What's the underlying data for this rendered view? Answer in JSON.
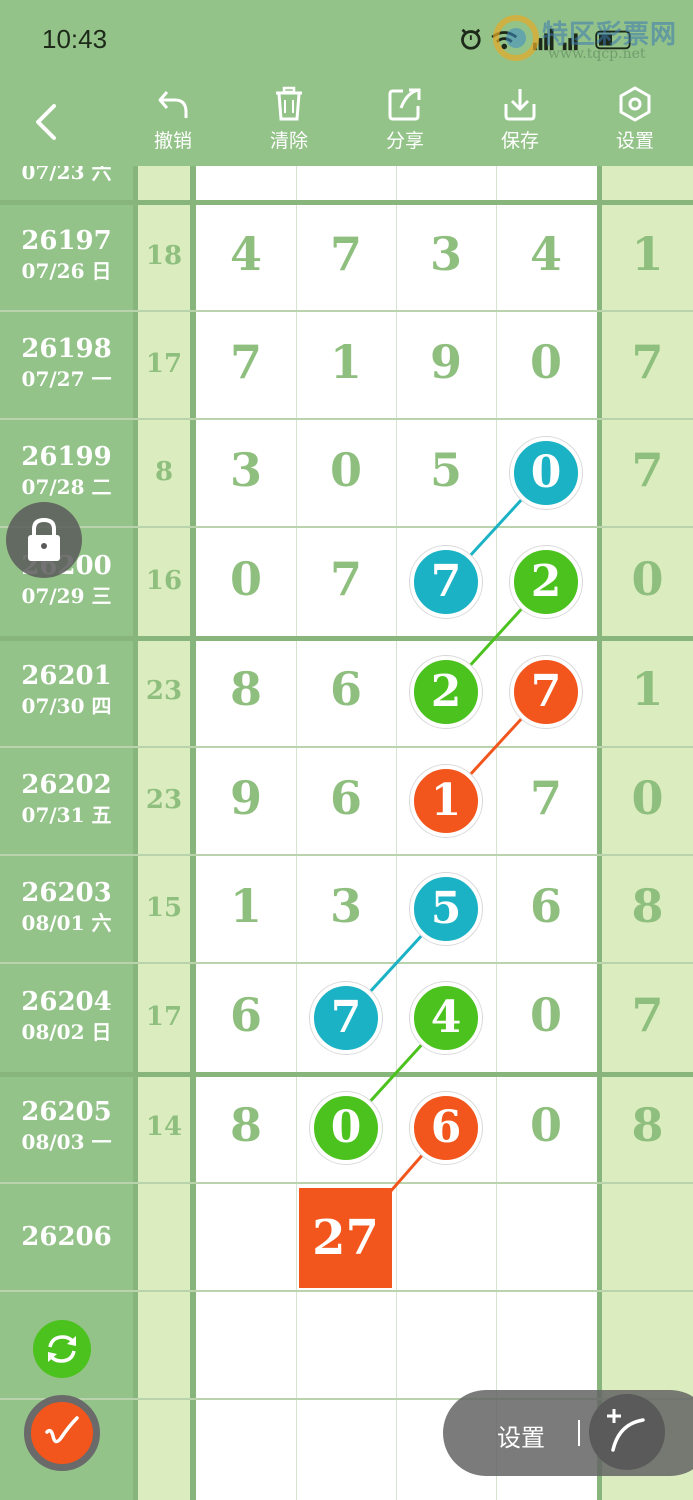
{
  "status_bar": {
    "time": "10:43",
    "signal": "5G"
  },
  "watermark": {
    "name": "特区彩票网",
    "url": "www.tqcp.net"
  },
  "toolbar": {
    "undo_label": "撤销",
    "clear_label": "清除",
    "share_label": "分享",
    "save_label": "保存",
    "settings_label": "设置"
  },
  "partial_top_row": {
    "date": "07/23 六"
  },
  "rows": [
    {
      "id": "26197",
      "date": "07/26 日",
      "sum": "18",
      "digits": [
        "4",
        "7",
        "3",
        "4"
      ],
      "extra": "1"
    },
    {
      "id": "26198",
      "date": "07/27 一",
      "sum": "17",
      "digits": [
        "7",
        "1",
        "9",
        "0"
      ],
      "extra": "7"
    },
    {
      "id": "26199",
      "date": "07/28 二",
      "sum": "8",
      "digits": [
        "3",
        "0",
        "5",
        "0"
      ],
      "extra": "7"
    },
    {
      "id": "26200",
      "date": "07/29 三",
      "sum": "16",
      "digits": [
        "0",
        "7",
        "7",
        "2"
      ],
      "extra": "0"
    },
    {
      "id": "26201",
      "date": "07/30 四",
      "sum": "23",
      "digits": [
        "8",
        "6",
        "2",
        "7"
      ],
      "extra": "1"
    },
    {
      "id": "26202",
      "date": "07/31 五",
      "sum": "23",
      "digits": [
        "9",
        "6",
        "1",
        "7"
      ],
      "extra": "0"
    },
    {
      "id": "26203",
      "date": "08/01 六",
      "sum": "15",
      "digits": [
        "1",
        "3",
        "5",
        "6"
      ],
      "extra": "8"
    },
    {
      "id": "26204",
      "date": "08/02 日",
      "sum": "17",
      "digits": [
        "6",
        "7",
        "4",
        "0"
      ],
      "extra": "7"
    },
    {
      "id": "26205",
      "date": "08/03 一",
      "sum": "14",
      "digits": [
        "8",
        "0",
        "6",
        "0"
      ],
      "extra": "8"
    },
    {
      "id": "26206",
      "date": "",
      "sum": "",
      "digits": [
        "",
        "",
        "",
        ""
      ],
      "extra": ""
    }
  ],
  "prediction": {
    "value": "27"
  },
  "highlights": [
    {
      "row": 2,
      "col": 3,
      "color": "teal"
    },
    {
      "row": 3,
      "col": 2,
      "color": "teal"
    },
    {
      "row": 3,
      "col": 3,
      "color": "green"
    },
    {
      "row": 4,
      "col": 2,
      "color": "green"
    },
    {
      "row": 4,
      "col": 3,
      "color": "orange"
    },
    {
      "row": 5,
      "col": 2,
      "color": "orange"
    },
    {
      "row": 6,
      "col": 2,
      "color": "teal"
    },
    {
      "row": 7,
      "col": 1,
      "color": "teal"
    },
    {
      "row": 7,
      "col": 2,
      "color": "green"
    },
    {
      "row": 8,
      "col": 1,
      "color": "green"
    },
    {
      "row": 8,
      "col": 2,
      "color": "orange"
    }
  ],
  "colors": {
    "teal": "#1ab2c4",
    "green": "#4cc21e",
    "orange": "#f2561d",
    "frame": "#93c388"
  },
  "floating": {
    "settings_label": "设置",
    "lock_icon": "lock-icon",
    "refresh_icon": "refresh-icon",
    "pen_icon": "pen-icon"
  }
}
